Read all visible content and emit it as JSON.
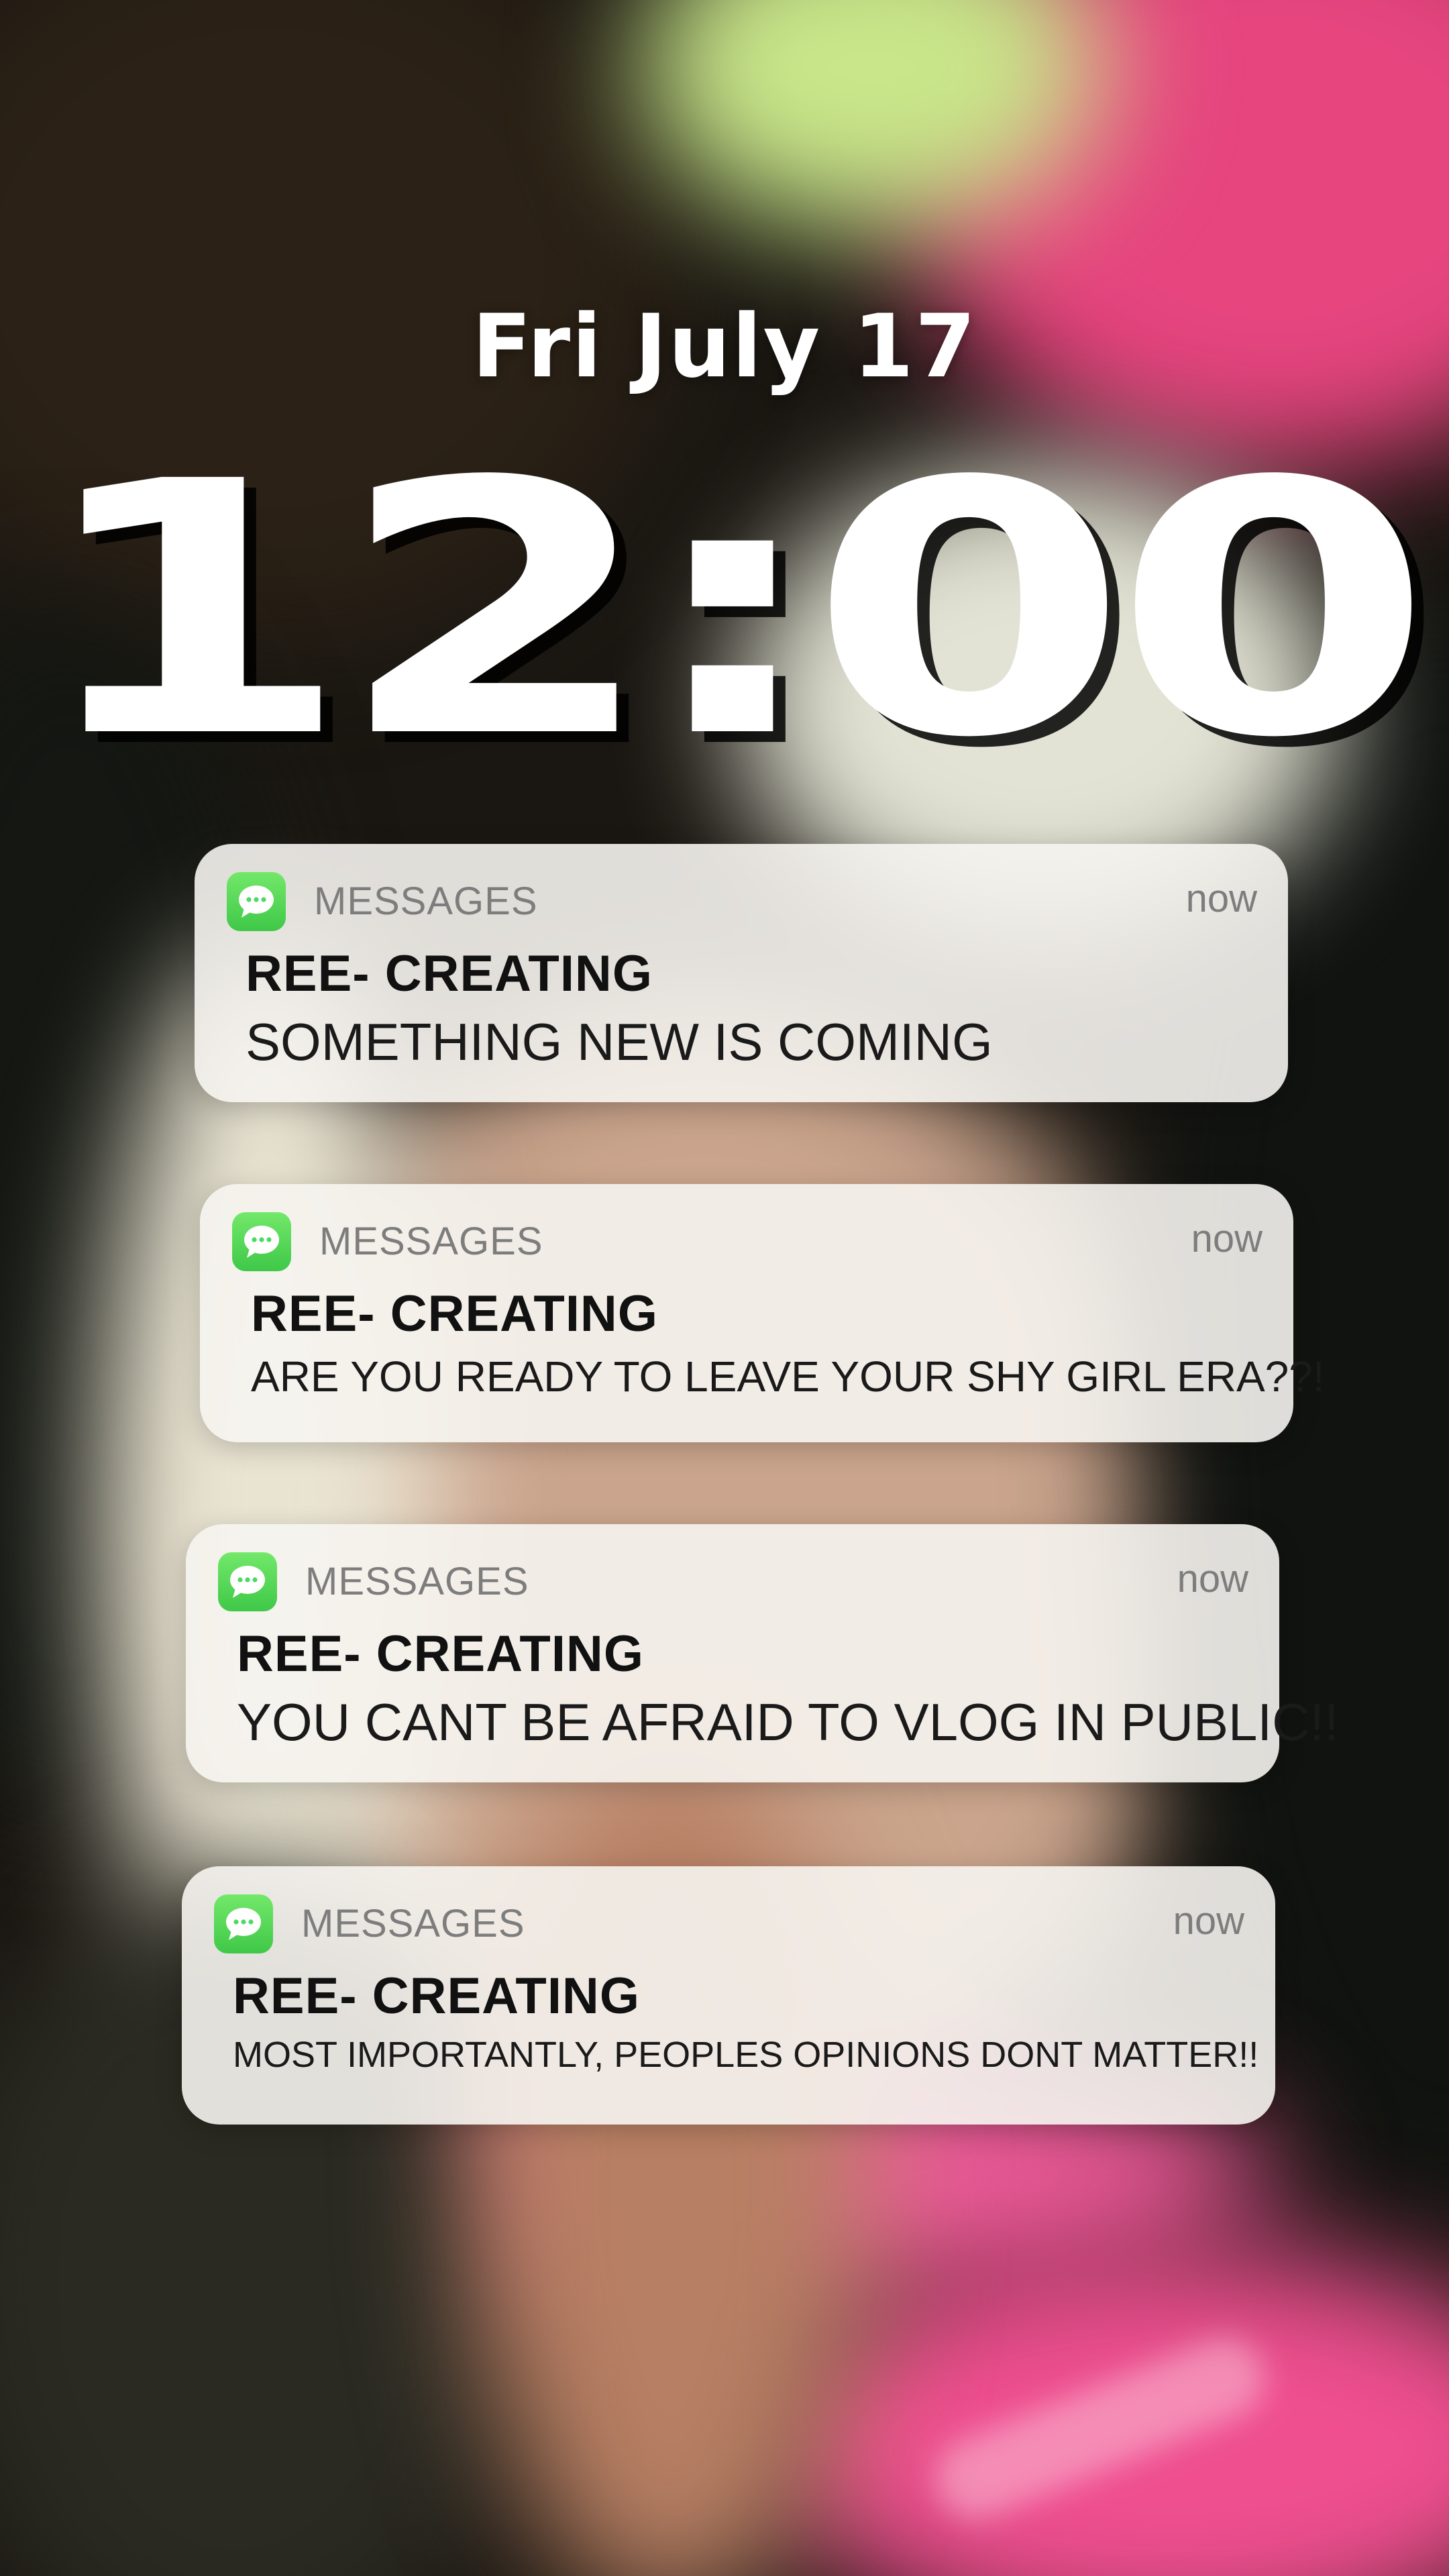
{
  "lock_screen": {
    "date": "Fri July 17",
    "time": "12:00"
  },
  "notifications": [
    {
      "app": "MESSAGES",
      "time": "now",
      "sender": "REE- CREATING",
      "body": "SOMETHING NEW IS COMING"
    },
    {
      "app": "MESSAGES",
      "time": "now",
      "sender": "REE- CREATING",
      "body": "ARE YOU READY TO LEAVE YOUR SHY GIRL ERA??!"
    },
    {
      "app": "MESSAGES",
      "time": "now",
      "sender": "REE- CREATING",
      "body": "YOU CANT BE AFRAID TO VLOG IN PUBLIC!!"
    },
    {
      "app": "MESSAGES",
      "time": "now",
      "sender": "REE- CREATING",
      "body": "MOST IMPORTANTLY, PEOPLES OPINIONS DONT MATTER!!"
    }
  ],
  "icons": {
    "app_icon": "messages-icon"
  },
  "colors": {
    "messages_green": "#4cd964",
    "notification_bg": "#f6f4f0",
    "accent_pink": "#ef5b9a"
  }
}
